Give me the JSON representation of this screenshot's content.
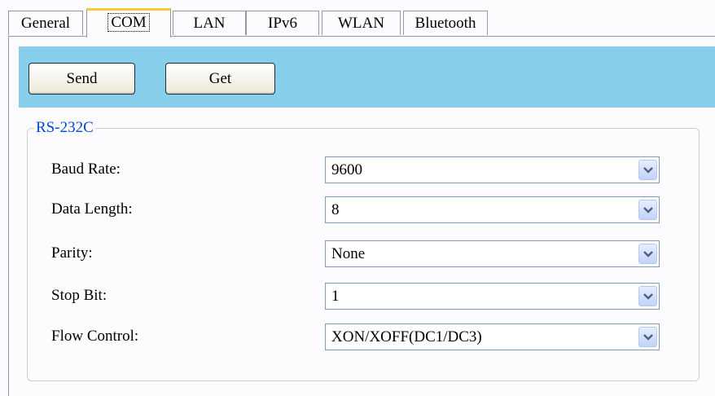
{
  "tabs": [
    {
      "label": "General",
      "active": false
    },
    {
      "label": "COM",
      "active": true
    },
    {
      "label": "LAN",
      "active": false
    },
    {
      "label": "IPv6",
      "active": false
    },
    {
      "label": "WLAN",
      "active": false
    },
    {
      "label": "Bluetooth",
      "active": false
    }
  ],
  "toolbar": {
    "send_label": "Send",
    "get_label": "Get",
    "color": "#87ceeb"
  },
  "group": {
    "legend": "RS-232C",
    "fields": [
      {
        "label": "Baud Rate:",
        "value": "9600"
      },
      {
        "label": "Data Length:",
        "value": "8"
      },
      {
        "label": "Parity:",
        "value": "None"
      },
      {
        "label": "Stop Bit:",
        "value": "1"
      },
      {
        "label": "Flow Control:",
        "value": "XON/XOFF(DC1/DC3)"
      }
    ]
  },
  "icons": {
    "dropdown": "chevron-down-icon"
  }
}
